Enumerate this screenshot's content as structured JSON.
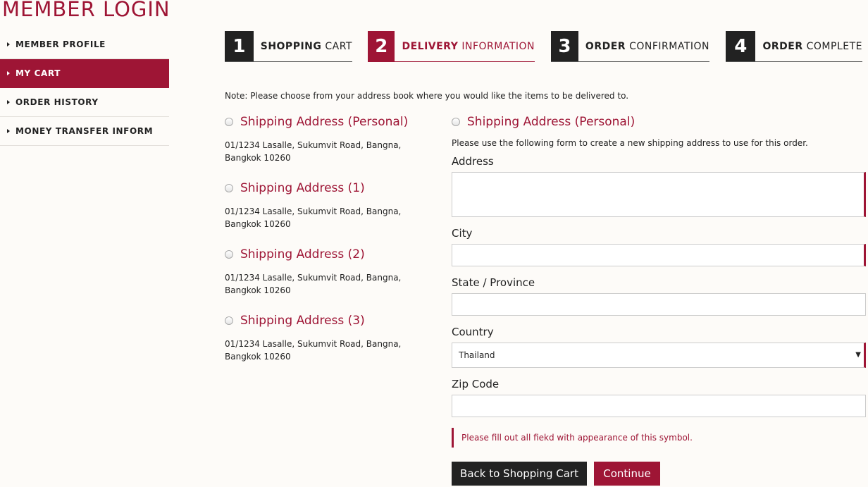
{
  "page": {
    "title": "MEMBER LOGIN"
  },
  "sidebar": {
    "items": [
      {
        "label": "MEMBER PROFILE"
      },
      {
        "label": "MY CART"
      },
      {
        "label": "ORDER HISTORY"
      },
      {
        "label": "MONEY TRANSFER INFORM"
      }
    ],
    "active_index": 1
  },
  "steps": [
    {
      "num": "1",
      "bold": "SHOPPING",
      "rest": "CART"
    },
    {
      "num": "2",
      "bold": "DELIVERY",
      "rest": "INFORMATION"
    },
    {
      "num": "3",
      "bold": "ORDER",
      "rest": "CONFIRMATION"
    },
    {
      "num": "4",
      "bold": "ORDER",
      "rest": "COMPLETE"
    }
  ],
  "active_step": 2,
  "note": "Note: Please choose from your address book where you would like the items to be delivered to.",
  "addresses": [
    {
      "title": "Shipping Address (Personal)",
      "line1": "01/1234 Lasalle, Sukumvit Road, Bangna,",
      "line2": "Bangkok 10260"
    },
    {
      "title": "Shipping Address (1)",
      "line1": "01/1234 Lasalle, Sukumvit Road, Bangna,",
      "line2": "Bangkok 10260"
    },
    {
      "title": "Shipping Address (2)",
      "line1": "01/1234 Lasalle, Sukumvit Road, Bangna,",
      "line2": "Bangkok 10260"
    },
    {
      "title": "Shipping Address (3)",
      "line1": "01/1234 Lasalle, Sukumvit Road, Bangna,",
      "line2": "Bangkok 10260"
    }
  ],
  "new_address": {
    "title": "Shipping Address (Personal)",
    "description": "Please use the following form to create a new shipping address to use for this order.",
    "address_label": "Address",
    "address_value": "",
    "city_label": "City",
    "city_value": "",
    "state_label": "State / Province",
    "state_value": "",
    "country_label": "Country",
    "country_value": "Thailand",
    "zip_label": "Zip Code",
    "zip_value": ""
  },
  "required_note": "Please fill out all fiekd with appearance of this symbol.",
  "buttons": {
    "back": "Back to Shopping Cart",
    "continue": "Continue"
  },
  "colors": {
    "accent": "#9e1535",
    "dark": "#222222",
    "background": "#fdfbf8"
  },
  "icons": {
    "sidebar_bullet": "triangle-right-icon",
    "select_arrow": "triangle-down-icon"
  }
}
